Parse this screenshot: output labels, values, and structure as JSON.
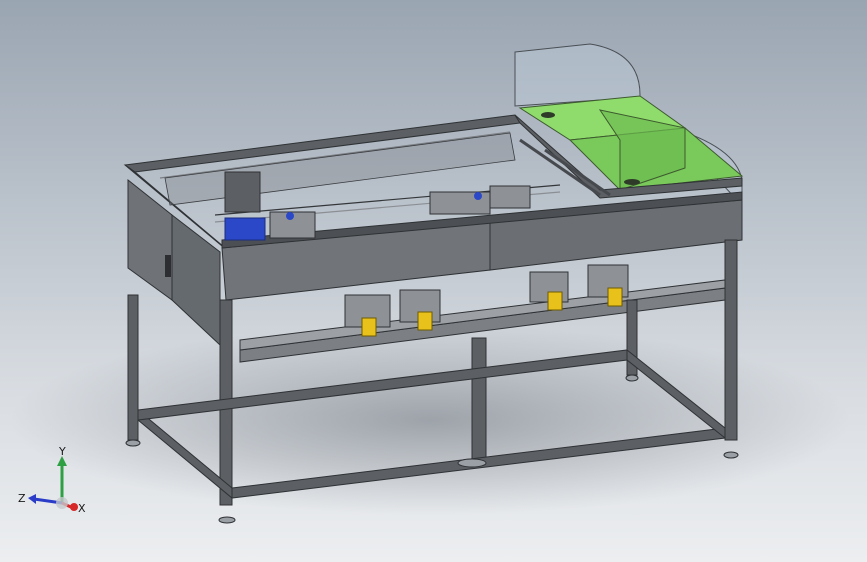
{
  "triad": {
    "x_label": "X",
    "y_label": "Y",
    "z_label": "Z",
    "x_color": "#d62828",
    "y_color": "#2ea043",
    "z_color": "#2b3cc8"
  },
  "colors": {
    "frame": "#5c5f63",
    "frame_dark": "#3e4145",
    "panel": "#6f7377",
    "cover_green": "#7fcf5f",
    "cover_glass": "#b9c6d4",
    "accent_yellow": "#e8c21a",
    "accent_blue": "#2b48c8"
  }
}
